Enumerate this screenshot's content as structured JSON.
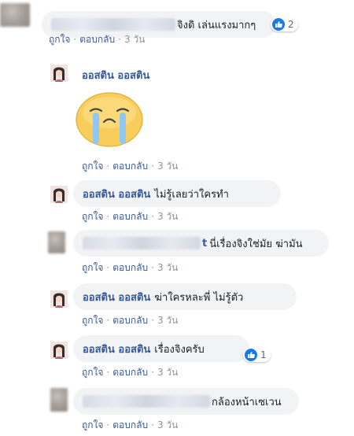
{
  "actions": {
    "like": "ถูกใจ",
    "reply": "ตอบกลับ",
    "time": "3 วัน",
    "sep": "·"
  },
  "comments": [
    {
      "text": "จิงดิ เล่นแรงมากๆ",
      "reactions": "2"
    },
    {
      "author": "ออสติน ออสติน"
    },
    {
      "author": "ออสติน ออสติน",
      "text": "ไม่รู้เลยว่าใครทำ"
    },
    {
      "text_suffix": "t",
      "text": "นี่เรื่องจิงใช่มัย ฆ่ามัน"
    },
    {
      "author": "ออสติน ออสติน",
      "text": "ฆ่าใครหละพี่ ไม่รู้ตัว"
    },
    {
      "author": "ออสติน ออสติน",
      "text": "เรื่องจิงครับ",
      "reactions": "1"
    },
    {
      "text": "กล้องหน้าเซเวน"
    }
  ],
  "colors": {
    "link": "#385898",
    "bubble": "#f2f3f5",
    "meta": "#8d949e",
    "like": "#1877f2"
  }
}
